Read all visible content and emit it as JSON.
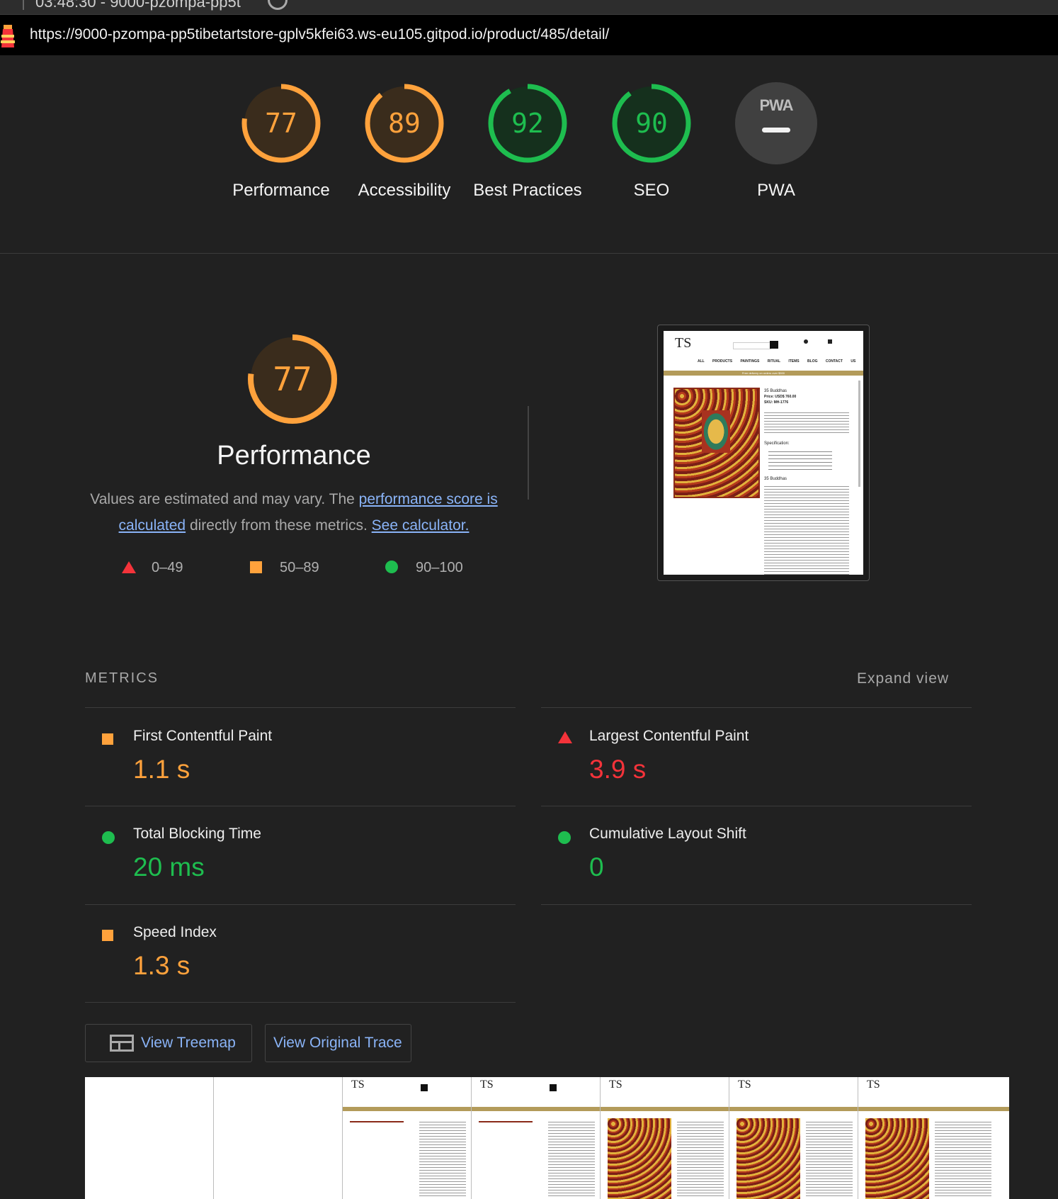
{
  "browser": {
    "tab_time": "03:48:30 - 9000-pzompa-pp5t",
    "url": "https://9000-pzompa-pp5tibetartstore-gplv5kfei63.ws-eu105.gitpod.io/product/485/detail/"
  },
  "summary_gauges": [
    {
      "label": "Performance",
      "score": "77",
      "value": 77,
      "status": "average"
    },
    {
      "label": "Accessibility",
      "score": "89",
      "value": 89,
      "status": "average"
    },
    {
      "label": "Best Practices",
      "score": "92",
      "value": 92,
      "status": "pass"
    },
    {
      "label": "SEO",
      "score": "90",
      "value": 90,
      "status": "pass"
    },
    {
      "label": "PWA",
      "badge": "PWA",
      "status": "na"
    }
  ],
  "performance": {
    "score": "77",
    "value": 77,
    "title": "Performance",
    "desc_prefix": "Values are estimated and may vary. The ",
    "desc_link1": "performance score is calculated",
    "desc_middle": " directly from these metrics. ",
    "desc_link2": "See calculator."
  },
  "legend": [
    {
      "range": "0–49",
      "shape": "triangle",
      "color": "#f4333a"
    },
    {
      "range": "50–89",
      "shape": "square",
      "color": "#ffa23c"
    },
    {
      "range": "90–100",
      "shape": "circle",
      "color": "#1ebd4f"
    }
  ],
  "screenshot": {
    "logo": "TS",
    "nav": [
      "ALL PRODUCTS",
      "PAINTINGS",
      "RITUAL ITEMS",
      "BLOG",
      "CONTACT US"
    ],
    "banner": "Free delivery on orders over $500",
    "product_name": "35 Buddhas",
    "price": "Price: USD$ 760.00",
    "sku": "SKU: MH-1776",
    "spec_heading": "Specification:",
    "section_heading": "35 Buddhas"
  },
  "metrics": {
    "heading": "METRICS",
    "expand": "Expand view",
    "items": [
      {
        "name": "First Contentful Paint",
        "value": "1.1 s",
        "status": "average"
      },
      {
        "name": "Largest Contentful Paint",
        "value": "3.9 s",
        "status": "fail"
      },
      {
        "name": "Total Blocking Time",
        "value": "20 ms",
        "status": "pass"
      },
      {
        "name": "Cumulative Layout Shift",
        "value": "0",
        "status": "pass"
      },
      {
        "name": "Speed Index",
        "value": "1.3 s",
        "status": "average"
      }
    ]
  },
  "buttons": {
    "treemap": "View Treemap",
    "trace": "View Original Trace"
  },
  "colors": {
    "average": "#ffa23c",
    "pass": "#1ebd4f",
    "fail": "#f4333a",
    "link": "#8ab4f8",
    "background": "#212121"
  }
}
